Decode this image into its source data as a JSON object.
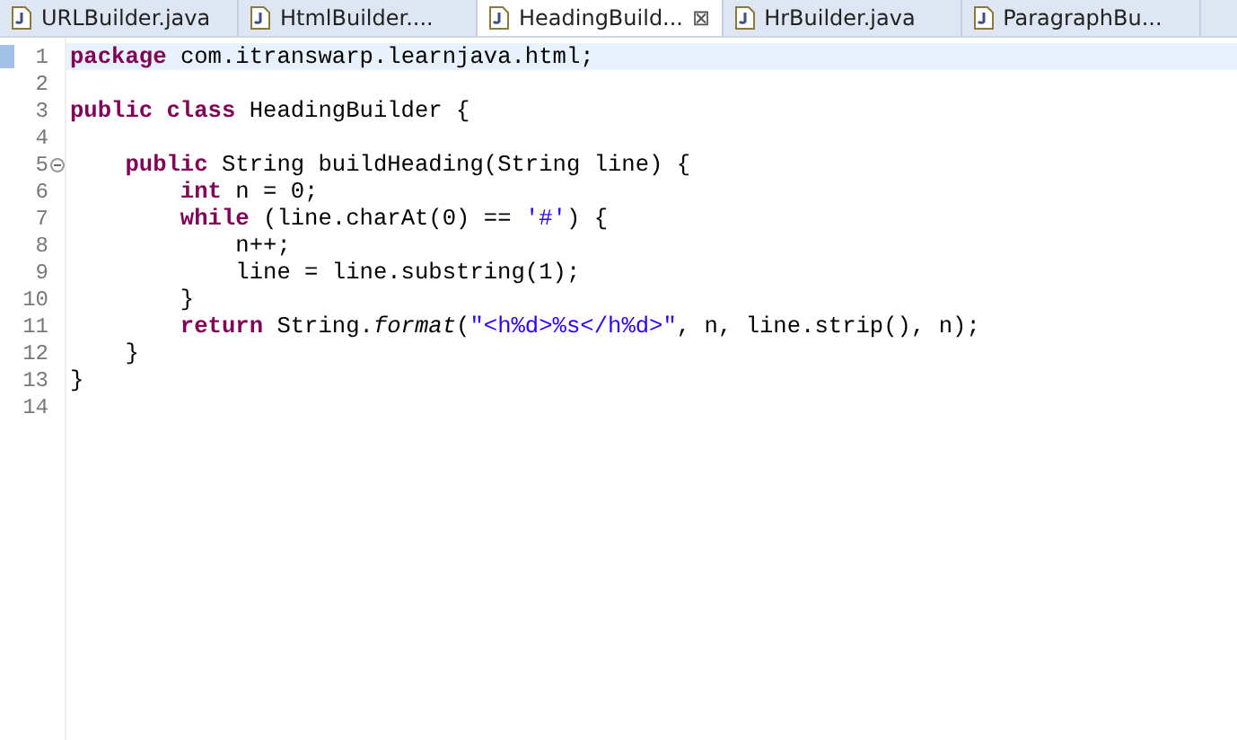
{
  "tabs": [
    {
      "label": "URLBuilder.java",
      "selected": false
    },
    {
      "label": "HtmlBuilder....",
      "selected": false
    },
    {
      "label": "HeadingBuild...",
      "selected": true,
      "close": "⊠"
    },
    {
      "label": "HrBuilder.java",
      "selected": false
    },
    {
      "label": "ParagraphBu...",
      "selected": false
    }
  ],
  "editor": {
    "lines": [
      {
        "number": "1",
        "current": true,
        "segments": [
          {
            "kind": "keyword",
            "text": "package"
          },
          {
            "kind": "plain",
            "text": " com.itranswarp.learnjava.html;"
          }
        ]
      },
      {
        "number": "2",
        "current": false
      },
      {
        "number": "3",
        "current": false,
        "segments": [
          {
            "kind": "keyword",
            "text": "public class"
          },
          {
            "kind": "plain",
            "text": " HeadingBuilder {"
          }
        ]
      },
      {
        "number": "4",
        "current": false
      },
      {
        "number": "5",
        "current": false,
        "fold": true,
        "segments": [
          {
            "kind": "keyword",
            "text": "    public"
          },
          {
            "kind": "plain",
            "text": " String buildHeading(String line) {"
          }
        ]
      },
      {
        "number": "6",
        "current": false,
        "segments": [
          {
            "kind": "keyword",
            "text": "        int"
          },
          {
            "kind": "plain",
            "text": " n = 0;"
          }
        ]
      },
      {
        "number": "7",
        "current": false,
        "segments": [
          {
            "kind": "keyword",
            "text": "        while"
          },
          {
            "kind": "plain",
            "text": " (line.charAt(0) == "
          },
          {
            "kind": "string",
            "text": "'#'"
          },
          {
            "kind": "plain",
            "text": ") {"
          }
        ]
      },
      {
        "number": "8",
        "current": false,
        "segments": [
          {
            "kind": "plain",
            "text": "            n++;"
          }
        ]
      },
      {
        "number": "9",
        "current": false,
        "segments": [
          {
            "kind": "plain",
            "text": "            line = line.substring(1);"
          }
        ]
      },
      {
        "number": "10",
        "current": false,
        "segments": [
          {
            "kind": "plain",
            "text": "        }"
          }
        ]
      },
      {
        "number": "11",
        "current": false,
        "segments": [
          {
            "kind": "keyword",
            "text": "        return"
          },
          {
            "kind": "plain",
            "text": " String."
          },
          {
            "kind": "static",
            "text": "format"
          },
          {
            "kind": "plain",
            "text": "("
          },
          {
            "kind": "string",
            "text": "\"<h%d>%s</h%d>\""
          },
          {
            "kind": "plain",
            "text": ", n, line.strip(), n);"
          }
        ]
      },
      {
        "number": "12",
        "current": false,
        "segments": [
          {
            "kind": "plain",
            "text": "    }"
          }
        ]
      },
      {
        "number": "13",
        "current": false,
        "segments": [
          {
            "kind": "plain",
            "text": "}"
          }
        ]
      },
      {
        "number": "14",
        "current": false
      }
    ]
  }
}
